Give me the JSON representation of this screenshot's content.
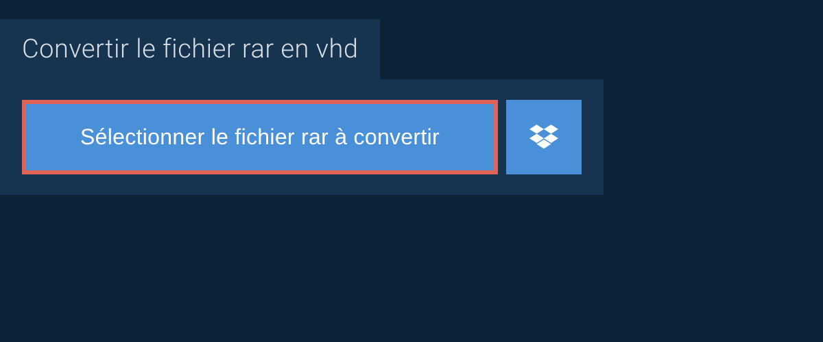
{
  "header": {
    "title": "Convertir le fichier rar en vhd"
  },
  "actions": {
    "select_file_label": "Sélectionner le fichier rar à convertir"
  },
  "colors": {
    "background": "#0d2438",
    "panel": "#163450",
    "button_primary": "#4a90d9",
    "highlight_border": "#e16257",
    "text_light": "#d8dde3"
  }
}
